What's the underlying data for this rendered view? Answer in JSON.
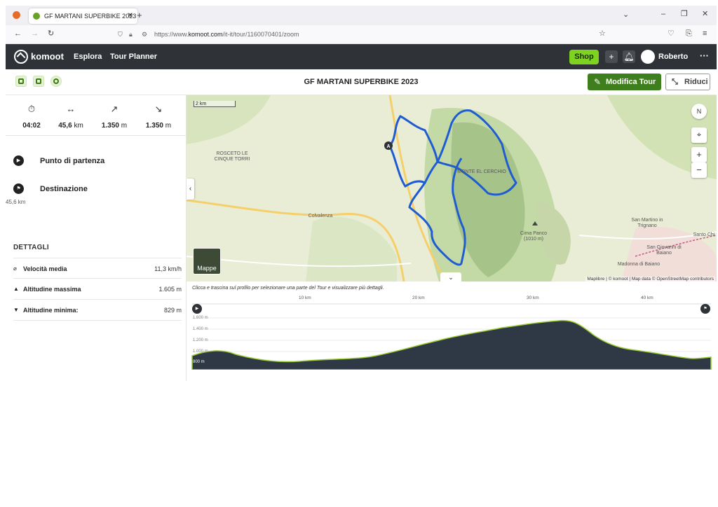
{
  "browser": {
    "tab_title": "GF MARTANI SUPERBIKE 2023",
    "url_prefix": "https://www.",
    "url_domain": "komoot.com",
    "url_path": "/it-it/tour/1160070401/zoom"
  },
  "header": {
    "brand": "komoot",
    "nav": [
      "Esplora",
      "Tour Planner"
    ],
    "shop_label": "Shop",
    "user_name": "Roberto",
    "colors": {
      "bar": "#2f3237",
      "shop": "#7ed321"
    }
  },
  "titlebar": {
    "title": "GF MARTANI SUPERBIKE 2023",
    "edit_label": "Modifica Tour",
    "reduce_label": "Riduci",
    "accent": "#3e7e1c"
  },
  "stats": [
    {
      "icon": "stopwatch-icon",
      "value": "04:02",
      "unit": ""
    },
    {
      "icon": "distance-icon",
      "value": "45,6",
      "unit": "km"
    },
    {
      "icon": "ascent-icon",
      "value": "1.350",
      "unit": "m"
    },
    {
      "icon": "descent-icon",
      "value": "1.350",
      "unit": "m"
    }
  ],
  "waypoints": {
    "start": "Punto di partenza",
    "end": "Destinazione",
    "end_distance": "45,6 km"
  },
  "details": {
    "title": "DETTAGLI",
    "rows": [
      {
        "icon": "speed-icon",
        "label": "Velocità media",
        "value": "11,3 km/h"
      },
      {
        "icon": "max-altitude-icon",
        "label": "Altitudine massima",
        "value": "1.605 m"
      },
      {
        "icon": "min-altitude-icon",
        "label": "Altitudine minima:",
        "value": "829 m"
      }
    ]
  },
  "map": {
    "scale": "2 km",
    "labels": [
      "ROSCETO LE CINQUE TORRI",
      "MONTE EL CERCHIO",
      "Colvalenza",
      "Cima Panco (1010 m)",
      "San Martino in Trignano",
      "Santo Chi",
      "San Giovanni di Baiano",
      "Madonna di Baiano"
    ],
    "layers_label": "Mappe",
    "compass": "N",
    "attribution": "Maplibre | © komoot | Map data © OpenStreetMap contributors",
    "start_marker": "A",
    "route_color": "#1f5bd1"
  },
  "profile": {
    "hint": "Clicca e trascina sul profilo per selezionare una parte del Tour e visualizzare più dettagli.",
    "x_ticks": [
      "10 km",
      "20 km",
      "30 km",
      "40 km"
    ],
    "y_ticks": [
      "1.600 m",
      "1.400 m",
      "1.200 m",
      "1.000 m",
      "800 m"
    ],
    "fill_color": "#2f3845"
  }
}
